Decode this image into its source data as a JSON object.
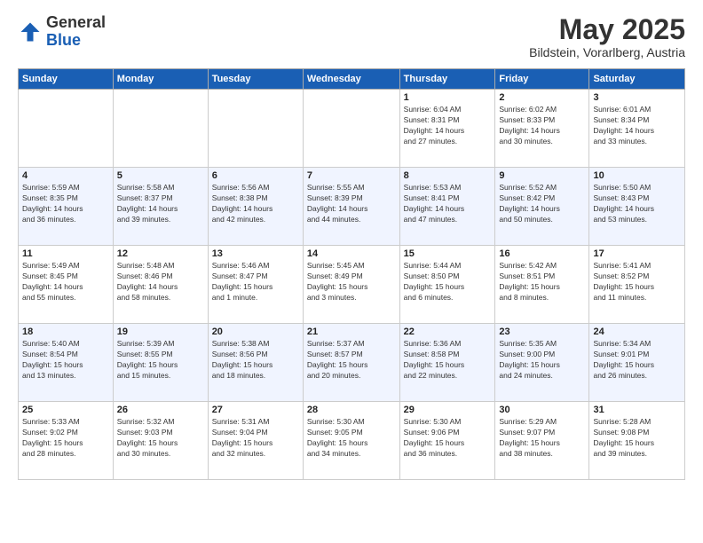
{
  "header": {
    "logo": {
      "line1": "General",
      "line2": "Blue"
    },
    "title": "May 2025",
    "subtitle": "Bildstein, Vorarlberg, Austria"
  },
  "weekdays": [
    "Sunday",
    "Monday",
    "Tuesday",
    "Wednesday",
    "Thursday",
    "Friday",
    "Saturday"
  ],
  "weeks": [
    [
      {
        "day": "",
        "info": ""
      },
      {
        "day": "",
        "info": ""
      },
      {
        "day": "",
        "info": ""
      },
      {
        "day": "",
        "info": ""
      },
      {
        "day": "1",
        "info": "Sunrise: 6:04 AM\nSunset: 8:31 PM\nDaylight: 14 hours\nand 27 minutes."
      },
      {
        "day": "2",
        "info": "Sunrise: 6:02 AM\nSunset: 8:33 PM\nDaylight: 14 hours\nand 30 minutes."
      },
      {
        "day": "3",
        "info": "Sunrise: 6:01 AM\nSunset: 8:34 PM\nDaylight: 14 hours\nand 33 minutes."
      }
    ],
    [
      {
        "day": "4",
        "info": "Sunrise: 5:59 AM\nSunset: 8:35 PM\nDaylight: 14 hours\nand 36 minutes."
      },
      {
        "day": "5",
        "info": "Sunrise: 5:58 AM\nSunset: 8:37 PM\nDaylight: 14 hours\nand 39 minutes."
      },
      {
        "day": "6",
        "info": "Sunrise: 5:56 AM\nSunset: 8:38 PM\nDaylight: 14 hours\nand 42 minutes."
      },
      {
        "day": "7",
        "info": "Sunrise: 5:55 AM\nSunset: 8:39 PM\nDaylight: 14 hours\nand 44 minutes."
      },
      {
        "day": "8",
        "info": "Sunrise: 5:53 AM\nSunset: 8:41 PM\nDaylight: 14 hours\nand 47 minutes."
      },
      {
        "day": "9",
        "info": "Sunrise: 5:52 AM\nSunset: 8:42 PM\nDaylight: 14 hours\nand 50 minutes."
      },
      {
        "day": "10",
        "info": "Sunrise: 5:50 AM\nSunset: 8:43 PM\nDaylight: 14 hours\nand 53 minutes."
      }
    ],
    [
      {
        "day": "11",
        "info": "Sunrise: 5:49 AM\nSunset: 8:45 PM\nDaylight: 14 hours\nand 55 minutes."
      },
      {
        "day": "12",
        "info": "Sunrise: 5:48 AM\nSunset: 8:46 PM\nDaylight: 14 hours\nand 58 minutes."
      },
      {
        "day": "13",
        "info": "Sunrise: 5:46 AM\nSunset: 8:47 PM\nDaylight: 15 hours\nand 1 minute."
      },
      {
        "day": "14",
        "info": "Sunrise: 5:45 AM\nSunset: 8:49 PM\nDaylight: 15 hours\nand 3 minutes."
      },
      {
        "day": "15",
        "info": "Sunrise: 5:44 AM\nSunset: 8:50 PM\nDaylight: 15 hours\nand 6 minutes."
      },
      {
        "day": "16",
        "info": "Sunrise: 5:42 AM\nSunset: 8:51 PM\nDaylight: 15 hours\nand 8 minutes."
      },
      {
        "day": "17",
        "info": "Sunrise: 5:41 AM\nSunset: 8:52 PM\nDaylight: 15 hours\nand 11 minutes."
      }
    ],
    [
      {
        "day": "18",
        "info": "Sunrise: 5:40 AM\nSunset: 8:54 PM\nDaylight: 15 hours\nand 13 minutes."
      },
      {
        "day": "19",
        "info": "Sunrise: 5:39 AM\nSunset: 8:55 PM\nDaylight: 15 hours\nand 15 minutes."
      },
      {
        "day": "20",
        "info": "Sunrise: 5:38 AM\nSunset: 8:56 PM\nDaylight: 15 hours\nand 18 minutes."
      },
      {
        "day": "21",
        "info": "Sunrise: 5:37 AM\nSunset: 8:57 PM\nDaylight: 15 hours\nand 20 minutes."
      },
      {
        "day": "22",
        "info": "Sunrise: 5:36 AM\nSunset: 8:58 PM\nDaylight: 15 hours\nand 22 minutes."
      },
      {
        "day": "23",
        "info": "Sunrise: 5:35 AM\nSunset: 9:00 PM\nDaylight: 15 hours\nand 24 minutes."
      },
      {
        "day": "24",
        "info": "Sunrise: 5:34 AM\nSunset: 9:01 PM\nDaylight: 15 hours\nand 26 minutes."
      }
    ],
    [
      {
        "day": "25",
        "info": "Sunrise: 5:33 AM\nSunset: 9:02 PM\nDaylight: 15 hours\nand 28 minutes."
      },
      {
        "day": "26",
        "info": "Sunrise: 5:32 AM\nSunset: 9:03 PM\nDaylight: 15 hours\nand 30 minutes."
      },
      {
        "day": "27",
        "info": "Sunrise: 5:31 AM\nSunset: 9:04 PM\nDaylight: 15 hours\nand 32 minutes."
      },
      {
        "day": "28",
        "info": "Sunrise: 5:30 AM\nSunset: 9:05 PM\nDaylight: 15 hours\nand 34 minutes."
      },
      {
        "day": "29",
        "info": "Sunrise: 5:30 AM\nSunset: 9:06 PM\nDaylight: 15 hours\nand 36 minutes."
      },
      {
        "day": "30",
        "info": "Sunrise: 5:29 AM\nSunset: 9:07 PM\nDaylight: 15 hours\nand 38 minutes."
      },
      {
        "day": "31",
        "info": "Sunrise: 5:28 AM\nSunset: 9:08 PM\nDaylight: 15 hours\nand 39 minutes."
      }
    ]
  ]
}
